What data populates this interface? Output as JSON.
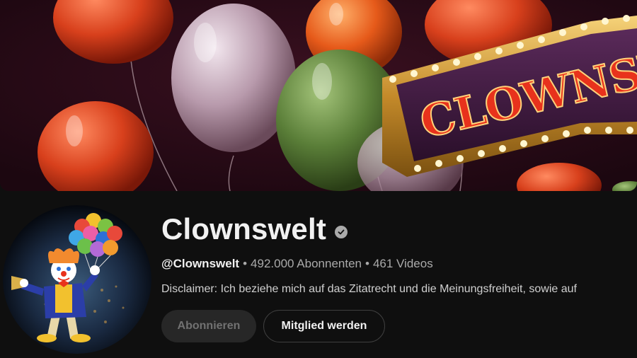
{
  "banner": {
    "sign_text": "CLOWNSW"
  },
  "channel": {
    "name": "Clownswelt",
    "verified_icon": "verified-check-icon",
    "handle": "@Clownswelt",
    "separator": "•",
    "subscribers": "492.000 Abonnenten",
    "videos": "461 Videos",
    "description": "Disclaimer: Ich beziehe mich auf das Zitatrecht und die Meinungsfreiheit, sowie auf"
  },
  "actions": {
    "subscribe_label": "Abonnieren",
    "member_label": "Mitglied werden"
  },
  "colors": {
    "background": "#0f0f0f",
    "text_primary": "#f1f1f1",
    "text_secondary": "#aaaaaa",
    "button_disabled_bg": "#272727"
  }
}
